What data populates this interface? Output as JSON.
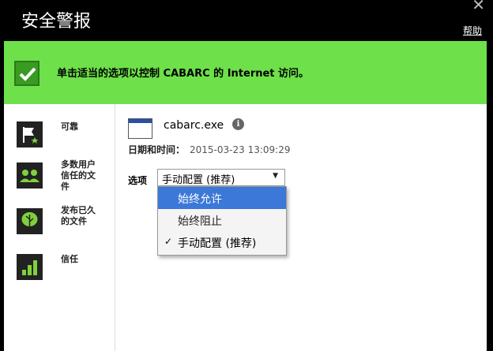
{
  "window": {
    "title": "安全警报",
    "help_label": "帮助",
    "close_glyph": "✕"
  },
  "banner": {
    "message": "单击适当的选项以控制 CABARC 的 Internet 访问。",
    "accent": "#6ee04a"
  },
  "sidebar": {
    "items": [
      {
        "label": "可靠",
        "icon": "flag-star-icon"
      },
      {
        "label": "多数用户信任的文件",
        "icon": "users-icon"
      },
      {
        "label": "发布已久的文件",
        "icon": "tree-icon"
      },
      {
        "label": "信任",
        "icon": "signal-bars-icon"
      }
    ]
  },
  "main": {
    "filename": "cabarc.exe",
    "info_glyph": "i",
    "date_label": "日期和时间：",
    "date_value": "2015-03-23 13:09:29",
    "options_label": "选项",
    "select_value": "手动配置 (推荐)",
    "options": [
      "始终允许",
      "始终阻止",
      "手动配置 (推荐)"
    ],
    "checkmark": "✓"
  }
}
